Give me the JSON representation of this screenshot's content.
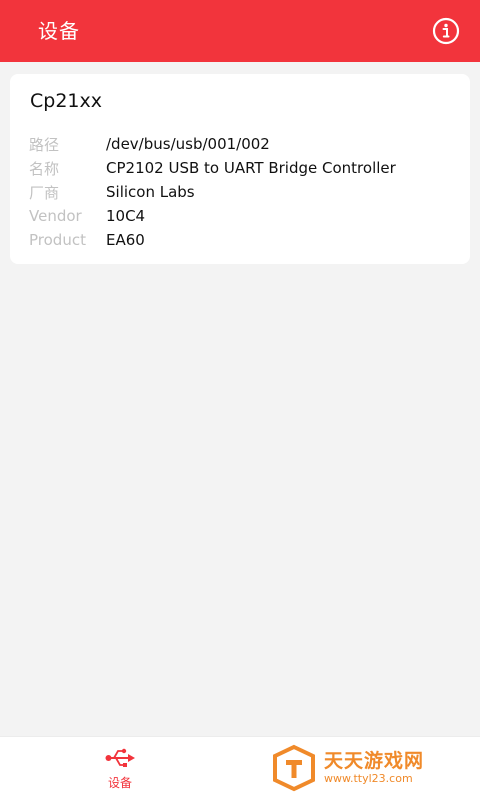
{
  "app_bar": {
    "title": "设备",
    "info_icon": "info-circle-icon"
  },
  "device": {
    "name": "Cp21xx",
    "properties": [
      {
        "key": "路径",
        "value": "/dev/bus/usb/001/002"
      },
      {
        "key": "名称",
        "value": "CP2102 USB to UART Bridge Controller"
      },
      {
        "key": "厂商",
        "value": "Silicon Labs"
      },
      {
        "key": "Vendor",
        "value": "10C4"
      },
      {
        "key": "Product",
        "value": "EA60"
      }
    ]
  },
  "bottom_nav": {
    "items": [
      {
        "label": "设备",
        "icon": "usb-icon",
        "active": true
      }
    ]
  },
  "watermark": {
    "name": "天天游戏网",
    "url": "www.ttyl23.com"
  },
  "colors": {
    "accent": "#f2343c",
    "background": "#f3f3f3",
    "muted_text": "#c2c2c2",
    "watermark": "#f08a2a"
  }
}
